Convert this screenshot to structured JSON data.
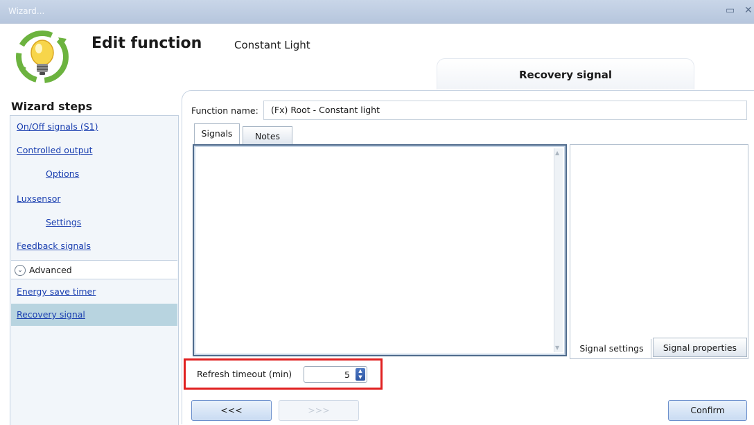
{
  "window": {
    "title": "Wizard...",
    "maximize_icon": "maximize-icon",
    "close_icon": "close-icon"
  },
  "header": {
    "title": "Edit function",
    "subtitle": "Constant Light",
    "current_step": "Recovery signal",
    "logo_icon": "lightbulb-cycle-icon"
  },
  "sidebar": {
    "heading": "Wizard steps",
    "items": [
      {
        "label": "On/Off signals (S1)"
      },
      {
        "label": "Controlled output"
      },
      {
        "label": "Options"
      },
      {
        "label": "Luxsensor"
      },
      {
        "label": "Settings"
      },
      {
        "label": "Feedback signals"
      }
    ],
    "advanced": {
      "label": "Advanced",
      "icon": "chevron-down-icon"
    },
    "advanced_items": [
      {
        "label": "Energy save timer"
      },
      {
        "label": "Recovery signal"
      }
    ]
  },
  "main": {
    "function_name_label": "Function name:",
    "function_name_value": "(Fx) Root - Constant light",
    "tabs": [
      {
        "label": "Signals"
      },
      {
        "label": "Notes"
      }
    ],
    "side_tabs": [
      {
        "label": "Signal settings"
      },
      {
        "label": "Signal properties"
      }
    ],
    "refresh": {
      "label": "Refresh timeout (min)",
      "value": "5"
    }
  },
  "footer": {
    "back_label": "<<<",
    "next_label": ">>>",
    "confirm_label": "Confirm"
  },
  "colors": {
    "accent_border": "#e02020",
    "active_step": "#b8d4e0",
    "link": "#1a3fb0"
  }
}
